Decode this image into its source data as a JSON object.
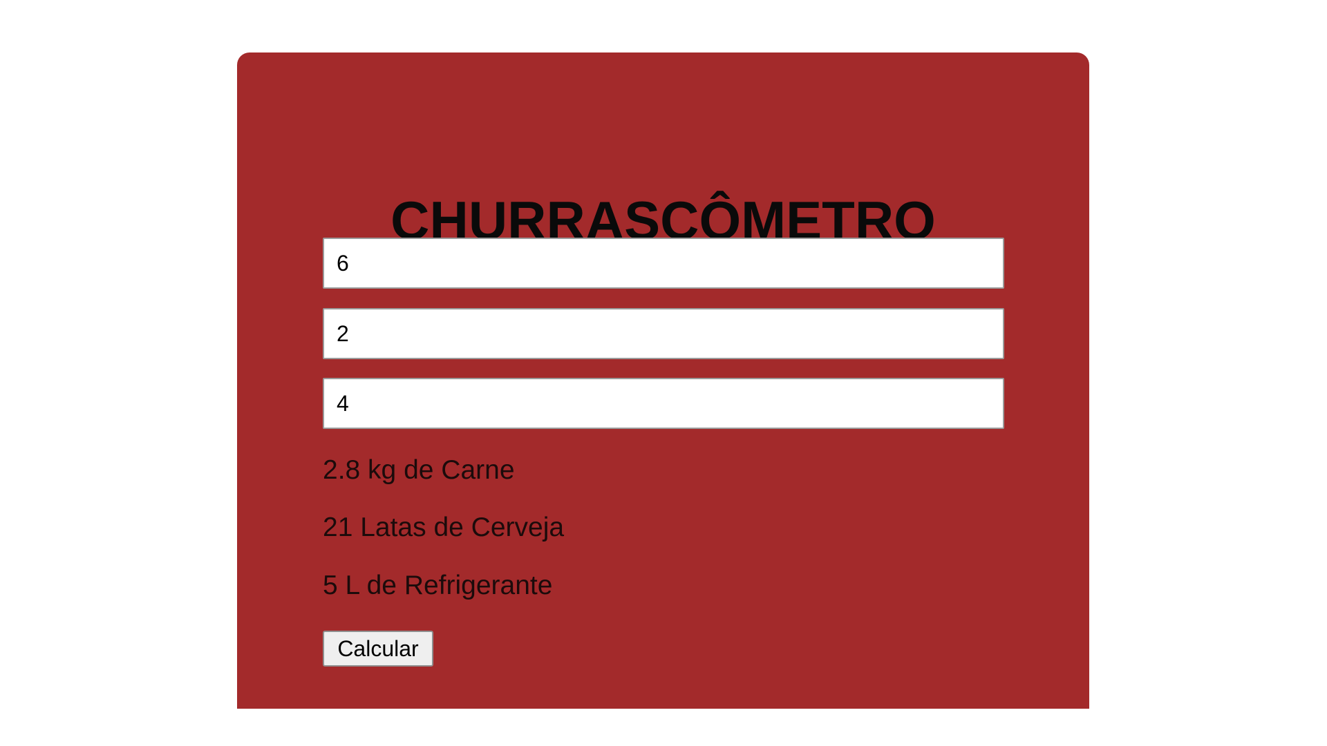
{
  "app": {
    "title": "CHURRASCÔMETRO"
  },
  "form": {
    "inputs": [
      {
        "value": "6"
      },
      {
        "value": "2"
      },
      {
        "value": "4"
      }
    ],
    "calculate_label": "Calcular"
  },
  "results": {
    "meat": "2.8 kg de Carne",
    "beer": "21 Latas de Cerveja",
    "soda": "5 L de Refrigerante"
  },
  "colors": {
    "card_background": "#a32a2b",
    "page_background": "#ffffff"
  }
}
